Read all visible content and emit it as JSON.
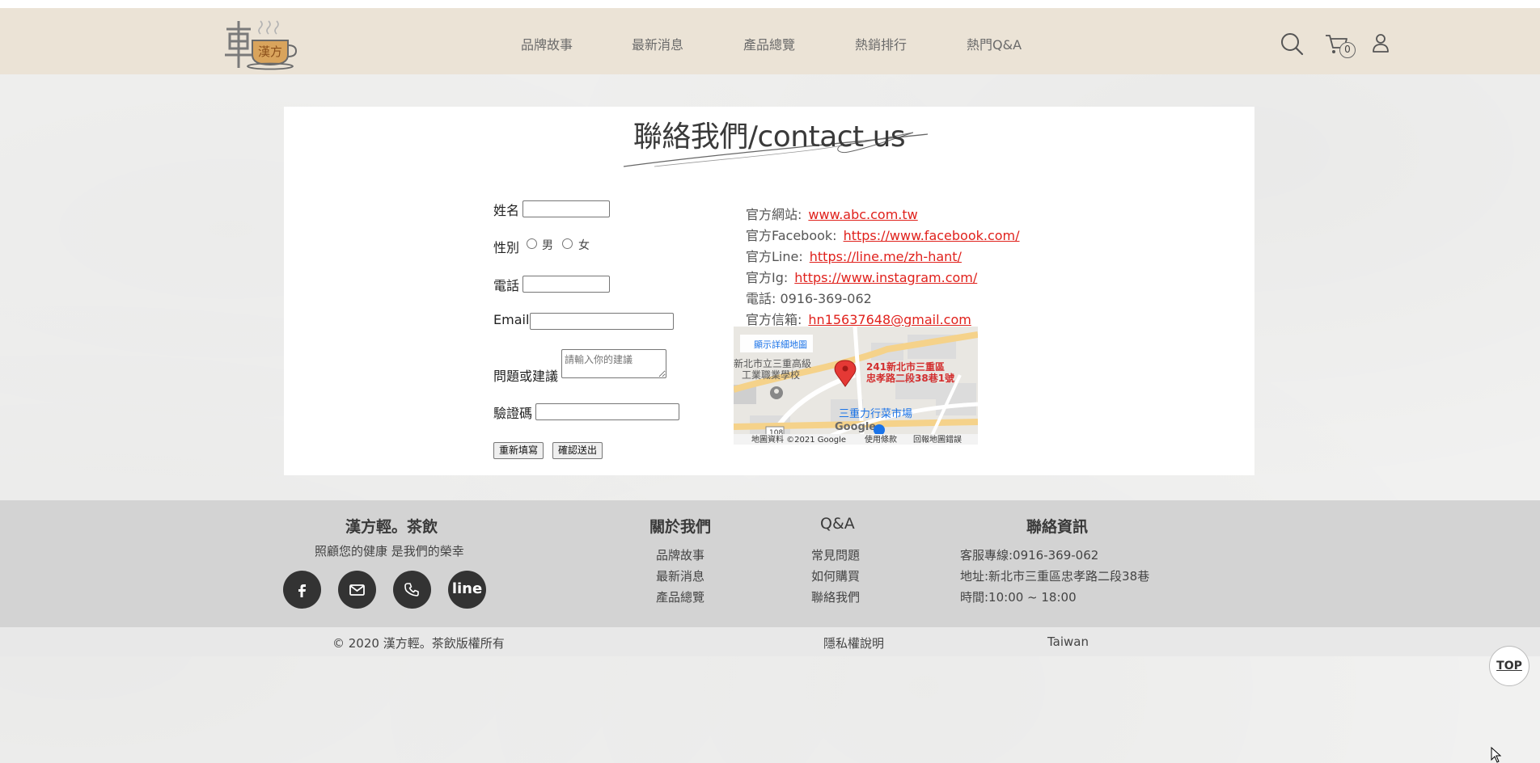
{
  "header": {
    "nav": [
      "品牌故事",
      "最新消息",
      "產品總覽",
      "熱銷排行",
      "熱門Q&A"
    ],
    "cart_count": "0",
    "logo_text": "漢方"
  },
  "main": {
    "title": "聯絡我們/contact us",
    "form": {
      "name_label": "姓名",
      "gender_label": "性別",
      "gender_male": "男",
      "gender_female": "女",
      "phone_label": "電話",
      "email_label": "Email",
      "suggestion_label": "問題或建議",
      "suggestion_placeholder": "請輸入你的建議",
      "captcha_label": "驗證碼",
      "reset_button": "重新填寫",
      "submit_button": "確認送出"
    },
    "info": {
      "website_label": "官方網站:",
      "website_link": "www.abc.com.tw",
      "facebook_label": "官方Facebook:",
      "facebook_link": "https://www.facebook.com/",
      "line_label": "官方Line:",
      "line_link": "https://line.me/zh-hant/",
      "ig_label": "官方Ig:",
      "ig_link": "https://www.instagram.com/",
      "phone": "電話: 0916-369-062",
      "email_label": "官方信箱:",
      "email_link": "hn15637648@gmail.com"
    },
    "map": {
      "view_larger": "顯示詳細地圖",
      "school": "新北市立三重高級工業職業學校",
      "school_l1": "新北市立三重高級",
      "school_l2": "工業職業學校",
      "address_l1": "241新北市三重區",
      "address_l2": "忠孝路二段38巷1號",
      "market": "三重力行菜市場",
      "google": "Google",
      "map_data": "地圖資料 ©2021 Google",
      "terms": "使用條款",
      "report": "回報地圖錯誤",
      "road_badge": "108"
    }
  },
  "footer": {
    "brand_title": "漢方輕。茶飲",
    "brand_slogan": "照顧您的健康 是我們的榮幸",
    "about_title": "關於我們",
    "about_links": [
      "品牌故事",
      "最新消息",
      "產品總覽"
    ],
    "qa_title": "Q&A",
    "qa_links": [
      "常見問題",
      "如何購買",
      "聯絡我們"
    ],
    "contact_title": "聯絡資訊",
    "contact_lines": [
      "客服專線:0916-369-062",
      "地址:新北市三重區忠孝路二段38巷",
      "時間:10:00 ~ 18:00"
    ],
    "line_btn": "line"
  },
  "bottom": {
    "copyright": "© 2020 漢方輕。茶飲版權所有",
    "privacy": "隱私權說明",
    "region": "Taiwan"
  },
  "top_button": "TOP",
  "colors": {
    "header_bg": "#ebe3d6",
    "link_red": "#e0211c",
    "footer_bg": "#d3d3d3"
  }
}
